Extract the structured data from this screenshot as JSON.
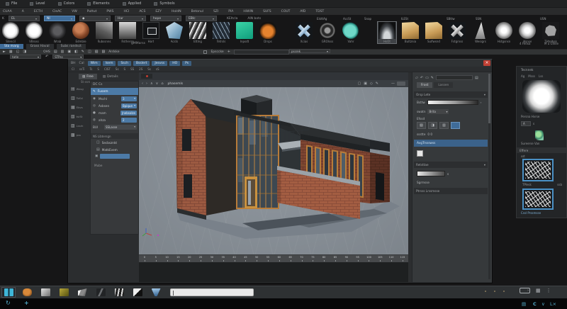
{
  "colors": {
    "accent_blue": "#4a7fae",
    "selection_blue": "#3f6c99",
    "viewport_bg": "#8b939b",
    "brick": "#9c5a41",
    "frame_orange": "#c08440",
    "close_red": "#c04034",
    "teal_icon": "#54aecd"
  },
  "menubar": {
    "items": [
      "File",
      "Level",
      "Colors",
      "Elements",
      "Applied",
      "Symbols"
    ]
  },
  "menubar2": {
    "items": [
      "CUAA",
      "A",
      "ECTH",
      "CleAC",
      "VW",
      "Puttut",
      "PWS",
      "HCI",
      "ACS",
      "EZY",
      "HoldN",
      "Betonul",
      "SZI",
      "PIA",
      "HiWIN",
      "SUFS",
      "COUT",
      "AfD",
      "TDST"
    ]
  },
  "comborow": {
    "prefix": "K",
    "combos": [
      {
        "label": "EL"
      },
      {
        "label": "NI",
        "extra": "active"
      },
      {
        "label": "◆"
      },
      {
        "label": "Har"
      },
      {
        "label": "hope"
      },
      {
        "label": "EBIc"
      }
    ],
    "trailing": [
      "KEItcla",
      "AIN bots"
    ]
  },
  "shelf": {
    "thumbs": [
      {
        "label": "Stencil",
        "cls": "th-fluff"
      },
      {
        "label": "VBross",
        "cls": "th-fluff"
      },
      {
        "label": "Wrab",
        "cls": "th-darkfluff"
      },
      {
        "label": "Edmble",
        "cls": "th-copper"
      },
      {
        "label": "Rubssnns",
        "cls": "th-tex"
      },
      {
        "label": "Rstherss",
        "cls": "th-grad"
      },
      {
        "label": "Hort",
        "cls": "th-hort"
      },
      {
        "label": "Acsts",
        "cls": "th-crystal"
      },
      {
        "label": "Ettlng",
        "cls": "th-stripe"
      },
      {
        "label": "Tetrsls",
        "cls": "th-scribble"
      },
      {
        "label": "Inpsdt",
        "cls": "th-teal"
      },
      {
        "label": "Drsps",
        "cls": "th-orangeblob"
      },
      {
        "label": "Xcias",
        "cls": "th-bluex",
        "extra": "gapL"
      },
      {
        "label": "GROlsss",
        "cls": "th-tire"
      },
      {
        "label": "Vahr",
        "cls": "th-paint"
      },
      {
        "label": "HsOt",
        "cls": "th-cave",
        "extra": "sel gapL"
      },
      {
        "label": "Bultznia",
        "cls": "th-tan"
      },
      {
        "label": "Sulfwsnd",
        "cls": "th-tan"
      },
      {
        "label": "Fstgrnss",
        "cls": "th-xsilver"
      },
      {
        "label": "Wesigrs",
        "cls": "th-wedge"
      },
      {
        "label": "Hstgsnsn",
        "cls": "th-soft"
      },
      {
        "label": "Jdsnse",
        "cls": "th-soft"
      },
      {
        "label": "THtelbsk",
        "cls": "th-blob"
      }
    ],
    "group_labels": [
      {
        "label": "EikttAg",
        "style": "left:447px"
      },
      {
        "label": "AccSt",
        "style": "left:484px"
      },
      {
        "label": "Snap",
        "style": "left:514px"
      },
      {
        "label": "ILESt",
        "style": "left:566px"
      },
      {
        "label": "SBttw",
        "style": "left:630px"
      },
      {
        "label": "SSN",
        "style": "left:671px"
      },
      {
        "label": "USN",
        "style": "left:762px"
      }
    ]
  },
  "tabstrip": {
    "tabs": [
      {
        "label": "Sta marg",
        "extra": "active"
      },
      {
        "label": "Grass Haval"
      },
      {
        "label": "Subs randsct"
      }
    ],
    "center_label": "gMMarss"
  },
  "toolrow": {
    "label1": "OHS",
    "label2": "Ardske",
    "snap_label": "Epsccke",
    "combo": "pssrek",
    "right_texts": {
      "a": "4 Fellxa",
      "b": "M u Gllnle"
    }
  },
  "subrow": {
    "combo1": "tatle",
    "combo2": "STPss"
  },
  "window": {
    "menu_pre": [
      "BH",
      "Cal"
    ],
    "menu": [
      {
        "label": "Wim"
      },
      {
        "label": "Isem"
      },
      {
        "label": "Ssch"
      },
      {
        "label": "Bsslert"
      },
      {
        "label": "Jesvss"
      },
      {
        "label": "HO"
      },
      {
        "label": "Ps"
      }
    ],
    "toolbar_items": [
      "Cl",
      "ssTi",
      "Ts",
      "S",
      "CIST",
      "Ss",
      "S",
      "SS",
      "2S",
      "Ss",
      "sS"
    ],
    "close": "×"
  },
  "left_dock": {
    "tabs": [
      {
        "label": "Free",
        "extra": "active"
      },
      {
        "label": "Details"
      }
    ],
    "subhead": "St ssrs",
    "rail": [
      {
        "icon": "▤",
        "label": "Wssg"
      },
      {
        "icon": "▥",
        "label": "TsKsl"
      },
      {
        "icon": "▦",
        "label": "Ebvs"
      },
      {
        "icon": "▧",
        "label": "tstSt"
      },
      {
        "icon": "▨",
        "label": "Lssrk"
      },
      {
        "icon": "▩",
        "label": "pss"
      }
    ],
    "props": {
      "header": "DC Cs",
      "active_row": {
        "icon": "✎",
        "label": "Fusem"
      },
      "rows": [
        {
          "icon": "◉",
          "label": "Mschl",
          "value": "3",
          "arrow": "▾"
        },
        {
          "icon": "◎",
          "label": "Asbsen",
          "value": "Bpique",
          "arrow": "▾"
        },
        {
          "icon": "●",
          "label": "mam",
          "value": "Jnebsolze",
          "arrow": ""
        },
        {
          "icon": "◍",
          "label": "ahza",
          "value": "2",
          "arrow": ""
        }
      ],
      "mode_row": {
        "label": "BUl",
        "value": "SSLasse",
        "arrow": "▾"
      },
      "section": "NS Libtersgn",
      "tree": [
        {
          "icon": "◫",
          "label": "Secbsznkt"
        },
        {
          "icon": "▤",
          "label": "MatkEvem"
        }
      ],
      "footer": "Mube"
    }
  },
  "viewport": {
    "scene_label": "phasemls",
    "timeline_ticks": [
      "0",
      "5",
      "10",
      "15",
      "20",
      "25",
      "30",
      "35",
      "40",
      "45",
      "50",
      "55",
      "60",
      "65",
      "70",
      "75",
      "80",
      "85",
      "90",
      "95",
      "100",
      "105",
      "110",
      "115"
    ]
  },
  "right_dock": {
    "tabs": [
      {
        "label": "Frost",
        "extra": "active"
      },
      {
        "label": "Lassen"
      }
    ],
    "sec1": "Orsp Lete",
    "sec1_arrow": "▾",
    "slider_label": "Bsttw",
    "dropdown": {
      "label": "swatn",
      "value": "Brita",
      "arrow": "▾"
    },
    "blend_label": "Efssd",
    "blend_icons": [
      "▧",
      "◨",
      "▥"
    ],
    "count": {
      "label": "ssstte",
      "value": "0 0"
    },
    "link": "AvgTrssswss",
    "sec2": "Retsttae",
    "sec2_arrow": "▾",
    "field_suffix": "s",
    "label3": "Sgrmsse",
    "sec3": "Ptrsss Lrssmsse"
  },
  "far_panel": {
    "title": "Tecnnek",
    "tools": [
      "Ag",
      "Msss",
      "Lss"
    ],
    "preview_label": "Persna Hvrse",
    "field": {
      "value": "A",
      "suffix": "s"
    },
    "sprite_label": "Sureerse Van",
    "sec1": "Effere",
    "tiny": "sst",
    "thumb1_label": "TPlesk",
    "thumb1_side": "ssb",
    "bottom_label": "Cssl Prssmsse"
  },
  "taskbar": {
    "icons": [
      {
        "cls": "tb-teal",
        "extra": "active"
      },
      {
        "cls": "tb-amber"
      },
      {
        "cls": "tb-silver"
      },
      {
        "cls": "tb-olive"
      },
      {
        "cls": "tb-chrome"
      },
      {
        "cls": "tb-darkx"
      },
      {
        "cls": "tb-stripes"
      },
      {
        "cls": "tb-bw"
      },
      {
        "cls": "tb-bluev"
      }
    ],
    "tray": {
      "chevron": "›",
      "grid": "▦",
      "menu": "⋮"
    }
  },
  "dock_strip": {
    "refresh": "↻",
    "move": "+",
    "list": "▤",
    "c": "C",
    "chev": "∨",
    "close": "L×"
  }
}
